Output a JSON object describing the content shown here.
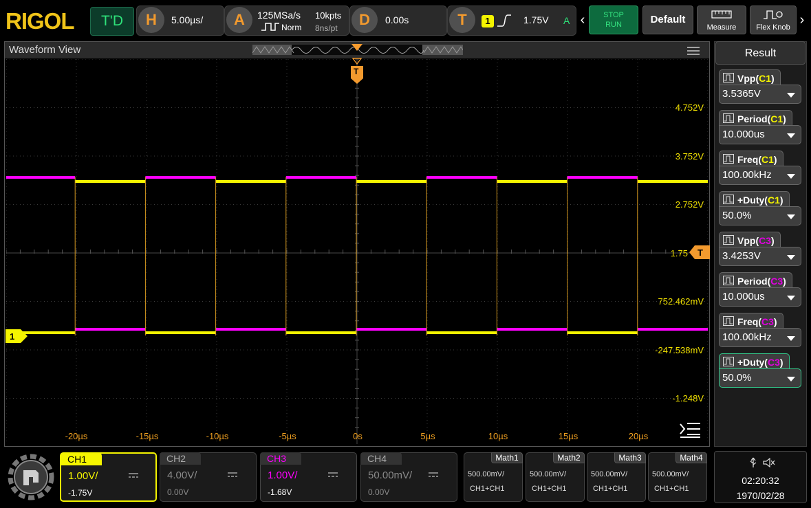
{
  "header": {
    "logo": "RIGOL",
    "trigger_mode_label": "T'D",
    "horizontal": {
      "key": "H",
      "timebase": "5.00µs/"
    },
    "acquire": {
      "key": "A",
      "sample_rate": "125MSa/s",
      "memory_depth": "10kpts",
      "mode": "Norm",
      "resolution": "8ns/pt"
    },
    "delay": {
      "key": "D",
      "value": "0.00s"
    },
    "trigger": {
      "key": "T",
      "channel": "1",
      "level": "1.75V",
      "sweep": "A"
    },
    "run_stop": {
      "stop": "STOP",
      "run": "RUN"
    },
    "buttons": {
      "default": "Default",
      "measure": "Measure",
      "flex_knob": "Flex Knob"
    }
  },
  "waveform_view": {
    "title": "Waveform View",
    "trigger_marker": "T",
    "level_marker": "T",
    "ch1_marker": "1",
    "trigger_level_label": "1.75",
    "y_labels": [
      "4.752V",
      "3.752V",
      "2.752V",
      "752.462mV",
      "-247.538mV",
      "-1.248V"
    ],
    "x_labels": [
      "-20µs",
      "-15µs",
      "-10µs",
      "-5µs",
      "0s",
      "5µs",
      "10µs",
      "15µs",
      "20µs"
    ],
    "colors": {
      "ch1": "#f5f500",
      "ch3": "#ff00ff",
      "trigger": "#f39a2e",
      "grid": "#3a3a3a"
    }
  },
  "result_panel": {
    "title": "Result",
    "items": [
      {
        "name": "Vpp",
        "source": "C1",
        "source_color": "#f5f500",
        "value": "3.5365V"
      },
      {
        "name": "Period",
        "source": "C1",
        "source_color": "#f5f500",
        "value": "10.000us"
      },
      {
        "name": "Freq",
        "source": "C1",
        "source_color": "#f5f500",
        "value": "100.00kHz"
      },
      {
        "name": "+Duty",
        "source": "C1",
        "source_color": "#f5f500",
        "value": "50.0%"
      },
      {
        "name": "Vpp",
        "source": "C3",
        "source_color": "#e000e0",
        "value": "3.4253V"
      },
      {
        "name": "Period",
        "source": "C3",
        "source_color": "#e000e0",
        "value": "10.000us"
      },
      {
        "name": "Freq",
        "source": "C3",
        "source_color": "#e000e0",
        "value": "100.00kHz"
      },
      {
        "name": "+Duty",
        "source": "C3",
        "source_color": "#e000e0",
        "value": "50.0%"
      }
    ]
  },
  "channels": [
    {
      "label": "CH1",
      "scale": "1.00V/",
      "offset": "-1.75V",
      "color": "#f5f500",
      "active": true
    },
    {
      "label": "CH2",
      "scale": "4.00V/",
      "offset": "0.00V",
      "color": "#9a9a9a",
      "active": false
    },
    {
      "label": "CH3",
      "scale": "1.00V/",
      "offset": "-1.68V",
      "color": "#ff00ff",
      "active": true
    },
    {
      "label": "CH4",
      "scale": "50.00mV/",
      "offset": "0.00V",
      "color": "#9a9a9a",
      "active": false
    }
  ],
  "math": [
    {
      "label": "Math1",
      "scale": "500.00mV/",
      "source": "CH1+CH1"
    },
    {
      "label": "Math2",
      "scale": "500.00mV/",
      "source": "CH1+CH1"
    },
    {
      "label": "Math3",
      "scale": "500.00mV/",
      "source": "CH1+CH1"
    },
    {
      "label": "Math4",
      "scale": "500.00mV/",
      "source": "CH1+CH1"
    }
  ],
  "status": {
    "time": "02:20:32",
    "date": "1970/02/28"
  }
}
